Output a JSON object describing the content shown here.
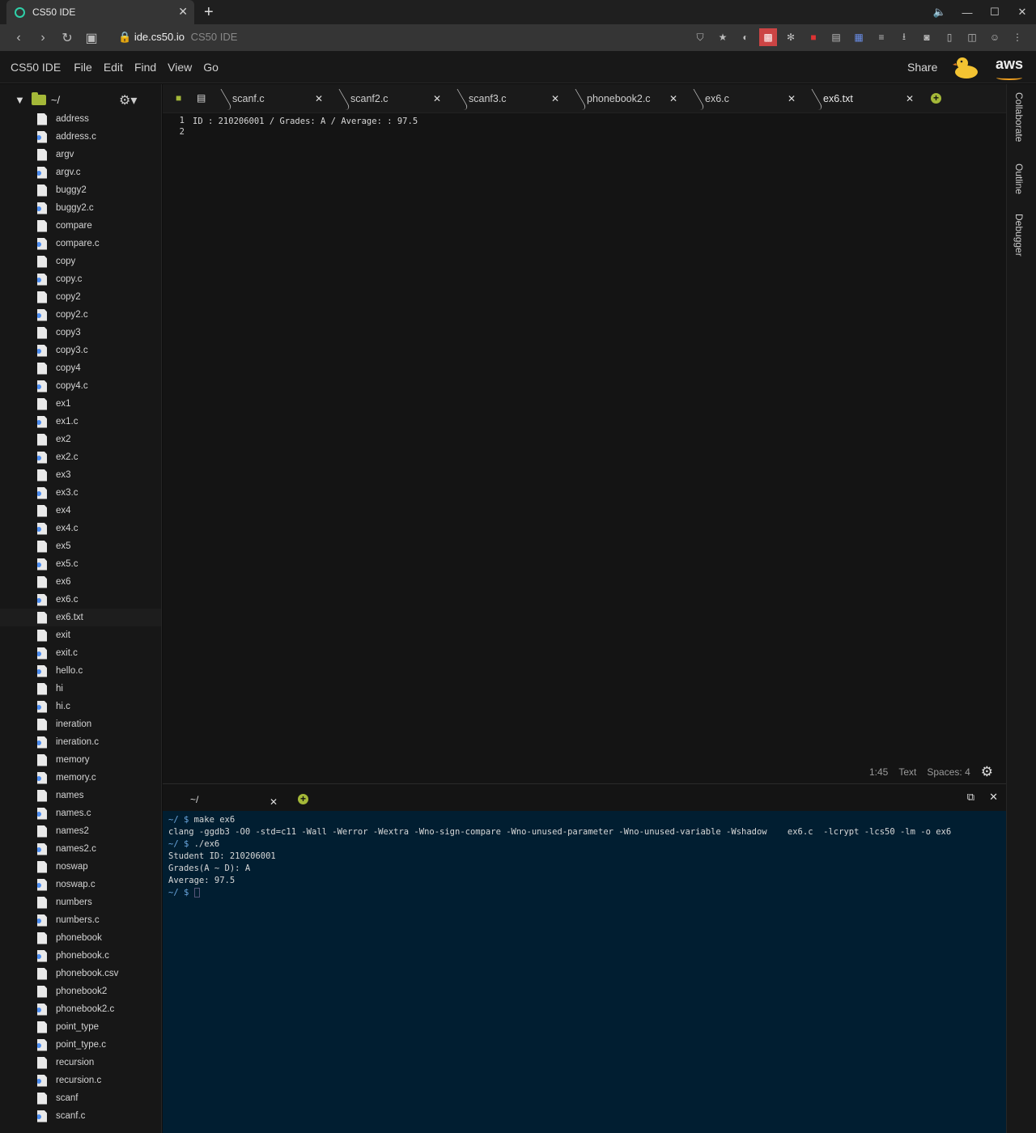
{
  "browser": {
    "tab_title": "CS50 IDE",
    "url_host": "ide.cs50.io",
    "url_suffix": "CS50 IDE"
  },
  "menu": {
    "brand": "CS50 IDE",
    "items": [
      "File",
      "Edit",
      "Find",
      "View",
      "Go"
    ],
    "share": "Share",
    "aws": "aws"
  },
  "sidebar": {
    "root": "~/",
    "files": [
      {
        "name": "address",
        "type": "bin"
      },
      {
        "name": "address.c",
        "type": "c"
      },
      {
        "name": "argv",
        "type": "bin"
      },
      {
        "name": "argv.c",
        "type": "c"
      },
      {
        "name": "buggy2",
        "type": "bin"
      },
      {
        "name": "buggy2.c",
        "type": "c"
      },
      {
        "name": "compare",
        "type": "bin"
      },
      {
        "name": "compare.c",
        "type": "c"
      },
      {
        "name": "copy",
        "type": "bin"
      },
      {
        "name": "copy.c",
        "type": "c"
      },
      {
        "name": "copy2",
        "type": "bin"
      },
      {
        "name": "copy2.c",
        "type": "c"
      },
      {
        "name": "copy3",
        "type": "bin"
      },
      {
        "name": "copy3.c",
        "type": "c"
      },
      {
        "name": "copy4",
        "type": "bin"
      },
      {
        "name": "copy4.c",
        "type": "c"
      },
      {
        "name": "ex1",
        "type": "bin"
      },
      {
        "name": "ex1.c",
        "type": "c"
      },
      {
        "name": "ex2",
        "type": "bin"
      },
      {
        "name": "ex2.c",
        "type": "c"
      },
      {
        "name": "ex3",
        "type": "bin"
      },
      {
        "name": "ex3.c",
        "type": "c"
      },
      {
        "name": "ex4",
        "type": "bin"
      },
      {
        "name": "ex4.c",
        "type": "c"
      },
      {
        "name": "ex5",
        "type": "bin"
      },
      {
        "name": "ex5.c",
        "type": "c"
      },
      {
        "name": "ex6",
        "type": "bin"
      },
      {
        "name": "ex6.c",
        "type": "c"
      },
      {
        "name": "ex6.txt",
        "type": "bin",
        "selected": true
      },
      {
        "name": "exit",
        "type": "bin"
      },
      {
        "name": "exit.c",
        "type": "c"
      },
      {
        "name": "hello.c",
        "type": "c"
      },
      {
        "name": "hi",
        "type": "bin"
      },
      {
        "name": "hi.c",
        "type": "c"
      },
      {
        "name": "ineration",
        "type": "bin"
      },
      {
        "name": "ineration.c",
        "type": "c"
      },
      {
        "name": "memory",
        "type": "bin"
      },
      {
        "name": "memory.c",
        "type": "c"
      },
      {
        "name": "names",
        "type": "bin"
      },
      {
        "name": "names.c",
        "type": "c"
      },
      {
        "name": "names2",
        "type": "bin"
      },
      {
        "name": "names2.c",
        "type": "c"
      },
      {
        "name": "noswap",
        "type": "bin"
      },
      {
        "name": "noswap.c",
        "type": "c"
      },
      {
        "name": "numbers",
        "type": "bin"
      },
      {
        "name": "numbers.c",
        "type": "c"
      },
      {
        "name": "phonebook",
        "type": "bin"
      },
      {
        "name": "phonebook.c",
        "type": "c"
      },
      {
        "name": "phonebook.csv",
        "type": "bin"
      },
      {
        "name": "phonebook2",
        "type": "bin"
      },
      {
        "name": "phonebook2.c",
        "type": "c"
      },
      {
        "name": "point_type",
        "type": "bin"
      },
      {
        "name": "point_type.c",
        "type": "c"
      },
      {
        "name": "recursion",
        "type": "bin"
      },
      {
        "name": "recursion.c",
        "type": "c"
      },
      {
        "name": "scanf",
        "type": "bin"
      },
      {
        "name": "scanf.c",
        "type": "c"
      }
    ]
  },
  "editor": {
    "tabs": [
      "scanf.c",
      "scanf2.c",
      "scanf3.c",
      "phonebook2.c",
      "ex6.c",
      "ex6.txt"
    ],
    "active_tab": "ex6.txt",
    "line_numbers": [
      "1",
      "2"
    ],
    "lines": [
      "ID : 210206001 / Grades: A / Average: : 97.5",
      ""
    ],
    "status": {
      "position": "1:45",
      "mode": "Text",
      "indent": "Spaces: 4"
    }
  },
  "terminal": {
    "tab": "~/",
    "lines": [
      {
        "prompt": "~/ $ ",
        "text": "make ex6"
      },
      {
        "prompt": "",
        "text": "clang -ggdb3 -O0 -std=c11 -Wall -Werror -Wextra -Wno-sign-compare -Wno-unused-parameter -Wno-unused-variable -Wshadow    ex6.c  -lcrypt -lcs50 -lm -o ex6"
      },
      {
        "prompt": "~/ $ ",
        "text": "./ex6"
      },
      {
        "prompt": "",
        "text": "Student ID: 210206001"
      },
      {
        "prompt": "",
        "text": "Grades(A ~ D): A"
      },
      {
        "prompt": "",
        "text": "Average: 97.5"
      },
      {
        "prompt": "~/ $ ",
        "text": ""
      }
    ]
  },
  "right_panel": [
    "Collaborate",
    "Outline",
    "Debugger"
  ]
}
